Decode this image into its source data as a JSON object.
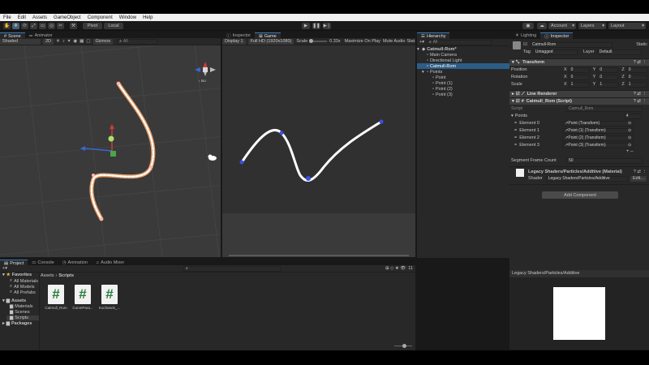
{
  "menubar": [
    "File",
    "Edit",
    "Assets",
    "GameObject",
    "Component",
    "Window",
    "Help"
  ],
  "toolbar": {
    "pivot": "Pivot",
    "local": "Local",
    "account": "Account",
    "layers": "Layers",
    "layout": "Layout"
  },
  "scene": {
    "tabs": [
      "Scene",
      "Animator"
    ],
    "shading": "Shaded",
    "mode_2d": "2D",
    "gizmos": "Gizmos",
    "search_placeholder": "All",
    "persp": "Iso"
  },
  "game": {
    "tabs": [
      "Inspector",
      "Game"
    ],
    "display": "Display 1",
    "resolution": "Full HD (1920x1080)",
    "scale_label": "Scale",
    "scale_value": "0.33x",
    "maximize": "Maximize On Play",
    "mute": "Mute Audio",
    "stats": "Stat"
  },
  "hierarchy": {
    "tab": "Hierarchy",
    "search_placeholder": "All",
    "scene_name": "Catmull-Rom*",
    "items": [
      "Main Camera",
      "Directional Light",
      "Catmull-Rom",
      "Points",
      "Point",
      "Point (1)",
      "Point (2)",
      "Point (3)"
    ]
  },
  "inspector": {
    "tabs": [
      "Lighting",
      "Inspector"
    ],
    "object_name": "Catmull-Rom",
    "static": "Static",
    "tag_label": "Tag",
    "tag_value": "Untagged",
    "layer_label": "Layer",
    "layer_value": "Default",
    "transform": {
      "title": "Transform",
      "position_label": "Position",
      "rotation_label": "Rotation",
      "scale_label": "Scale",
      "position": [
        "0",
        "0",
        "0"
      ],
      "rotation": [
        "0",
        "0",
        "0"
      ],
      "scale": [
        "1",
        "1",
        "1"
      ],
      "axis": [
        "X",
        "Y",
        "Z"
      ]
    },
    "line_renderer": "Line Renderer",
    "script_comp": {
      "title": "Catmull_Rom (Script)",
      "script_label": "Script",
      "script_value": "Catmull_Rom",
      "points_label": "Points",
      "points_count": "4",
      "elements": [
        {
          "label": "Element 0",
          "value": "↗Point (Transform)"
        },
        {
          "label": "Element 1",
          "value": "↗Point (1) (Transform)"
        },
        {
          "label": "Element 2",
          "value": "↗Point (2) (Transform)"
        },
        {
          "label": "Element 3",
          "value": "↗Point (3) (Transform)"
        }
      ],
      "frame_count_label": "Segment Frame Count",
      "frame_count_value": "50"
    },
    "material": {
      "title": "Legacy Shaders/Particles/Additive (Material)",
      "shader_label": "Shader",
      "shader_value": "Legacy Shaders/Particles/Additive",
      "edit": "Edit..."
    },
    "add_component": "Add Component",
    "preview_title": "Legacy Shaders/Particles/Additive"
  },
  "project": {
    "tabs": [
      "Project",
      "Console",
      "Animation",
      "Audio Mixer"
    ],
    "breadcrumb": [
      "Assets",
      "Scripts"
    ],
    "favorites": {
      "title": "Favorites",
      "items": [
        "All Materials",
        "All Models",
        "All Prefabs"
      ]
    },
    "assets": {
      "title": "Assets",
      "items": [
        "Materials",
        "Scenes",
        "Scripts"
      ]
    },
    "packages": "Packages",
    "files": [
      "Catmull_Rom",
      "CurvePara...",
      "Kochanek_..."
    ],
    "item_count": "11"
  },
  "colors": {
    "accent": "#3a79bb",
    "selection": "#2c5d87",
    "point_blue": "#3c4fe8",
    "spline_orange": "#e39b63"
  }
}
